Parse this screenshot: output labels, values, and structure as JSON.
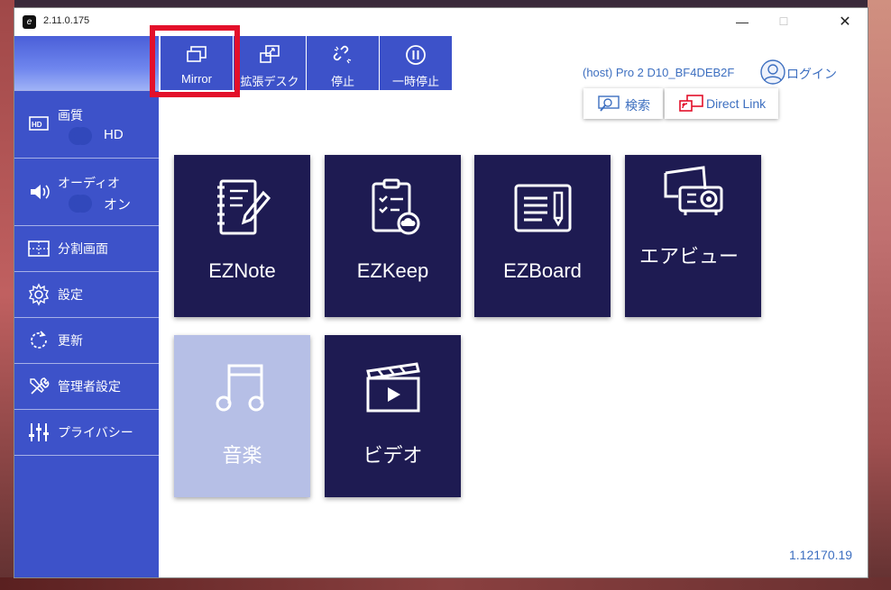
{
  "window": {
    "title": "2.11.0.175",
    "app_icon": "app-logo-icon"
  },
  "toolbar": {
    "mirror_label": "Mirror",
    "extend_label": "拡張デスク",
    "stop_label": "停止",
    "pause_label": "一時停止"
  },
  "sidebar": {
    "picture_label": "画質",
    "picture_value": "HD",
    "audio_label": "オーディオ",
    "audio_value": "オン",
    "split_label": "分割画面",
    "settings_label": "設定",
    "update_label": "更新",
    "admin_label": "管理者設定",
    "privacy_label": "プライバシー"
  },
  "header": {
    "host": "(host) Pro 2 D10_BF4DEB2F",
    "login": "ログイン",
    "search_label": "検索",
    "direct_link_label": "Direct Link"
  },
  "tiles": {
    "eznote": "EZNote",
    "ezkeep": "EZKeep",
    "ezboard": "EZBoard",
    "airview": "エアビュー",
    "music": "音楽",
    "video": "ビデオ"
  },
  "footer": {
    "version": "1.12170.19"
  },
  "colors": {
    "sidebar": "#3d52c9",
    "tile": "#1e1b52",
    "tile_disabled": "#b6bfe6",
    "highlight": "#e3102a",
    "link": "#3d6fc0"
  }
}
